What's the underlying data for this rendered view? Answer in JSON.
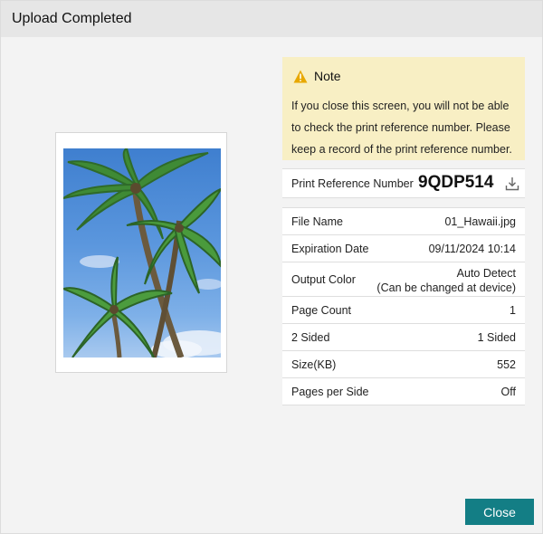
{
  "dialog": {
    "title": "Upload Completed",
    "close_label": "Close",
    "accent_color": "#137e85"
  },
  "preview": {
    "icon": "palm-tree-photo"
  },
  "note": {
    "title": "Note",
    "body": "If you close this screen, you will not be able to check the print reference number. Please keep a record of the print reference number.",
    "icon": "warning-icon",
    "background": "#f8efc4"
  },
  "reference": {
    "label": "Print Reference Number",
    "number": "9QDP514",
    "icon": "download-icon"
  },
  "details": {
    "rows": [
      {
        "label": "File Name",
        "value": "01_Hawaii.jpg"
      },
      {
        "label": "Expiration Date",
        "value": "09/11/2024 10:14"
      },
      {
        "label": "Output Color",
        "value_line1": "Auto Detect",
        "value_line2": "(Can be changed at device)"
      },
      {
        "label": "Page Count",
        "value": "1"
      },
      {
        "label": "2 Sided",
        "value": "1 Sided"
      },
      {
        "label": "Size(KB)",
        "value": "552"
      },
      {
        "label": "Pages per Side",
        "value": "Off"
      }
    ]
  }
}
